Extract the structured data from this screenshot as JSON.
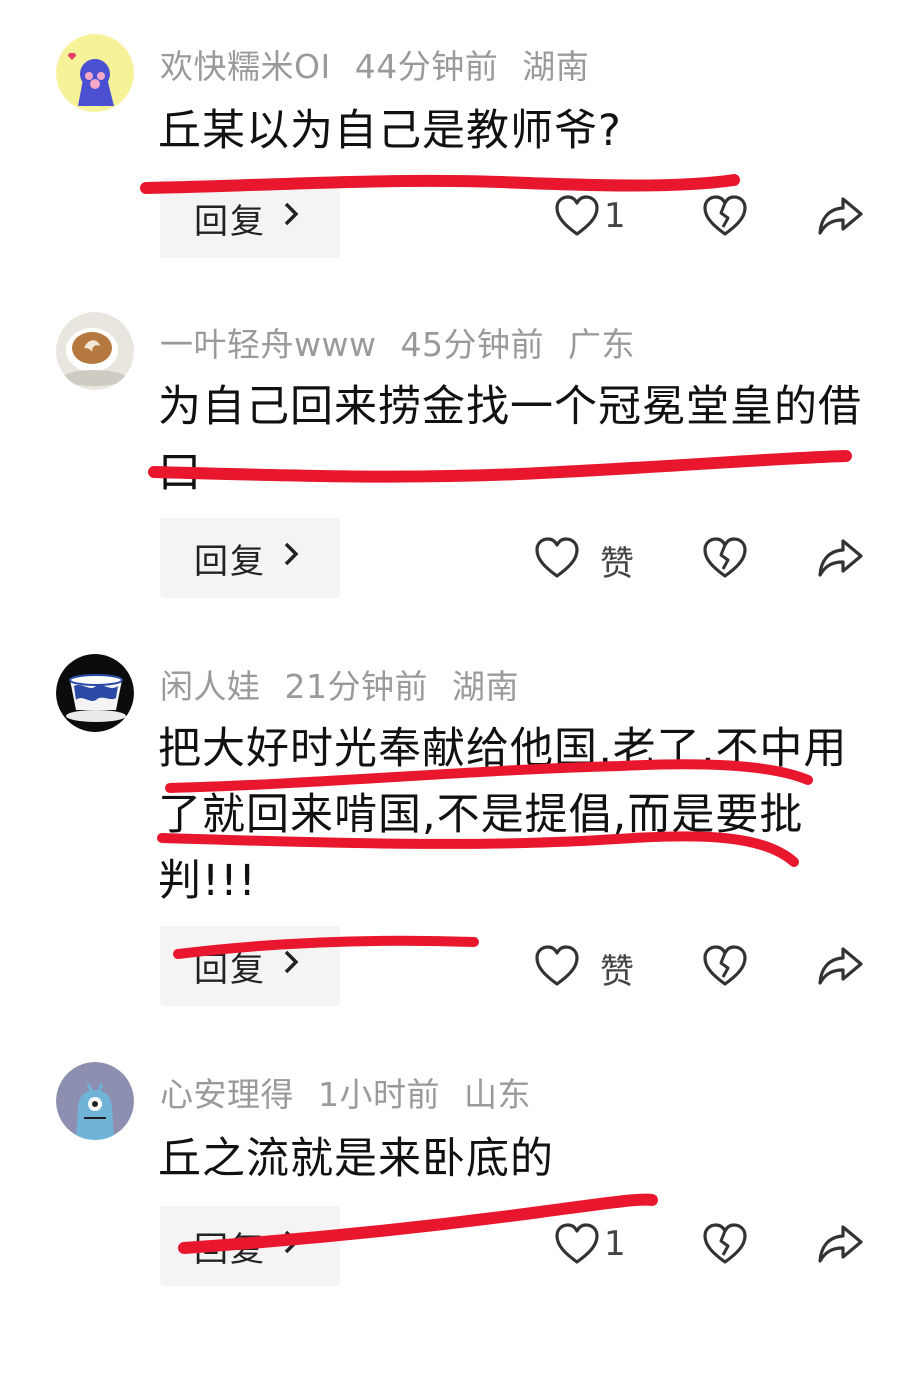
{
  "comments": [
    {
      "user": "欢快糯米OI",
      "time": "44分钟前",
      "location": "湖南",
      "text": "丘某以为自己是教师爷?",
      "reply_label": "回复",
      "like": "1",
      "avatar_icon": "paw-icon"
    },
    {
      "user": "一叶轻舟www",
      "time": "45分钟前",
      "location": "广东",
      "text": "为自己回来捞金找一个冠冕堂皇的借口",
      "reply_label": "回复",
      "like": "赞",
      "avatar_icon": "coffee-cup-icon"
    },
    {
      "user": "闲人娃",
      "time": "21分钟前",
      "location": "湖南",
      "text": "把大好时光奉献给他国,老了,不中用了就回来啃国,不是提倡,而是要批判!!!",
      "reply_label": "回复",
      "like": "赞",
      "avatar_icon": "porcelain-cup-icon"
    },
    {
      "user": "心安理得",
      "time": "1小时前",
      "location": "山东",
      "text": "丘之流就是来卧底的",
      "reply_label": "回复",
      "like": "1",
      "avatar_icon": "monster-icon"
    }
  ],
  "colors": {
    "marker": "#e8172e",
    "meta": "#9a9a9a",
    "text": "#111111"
  }
}
